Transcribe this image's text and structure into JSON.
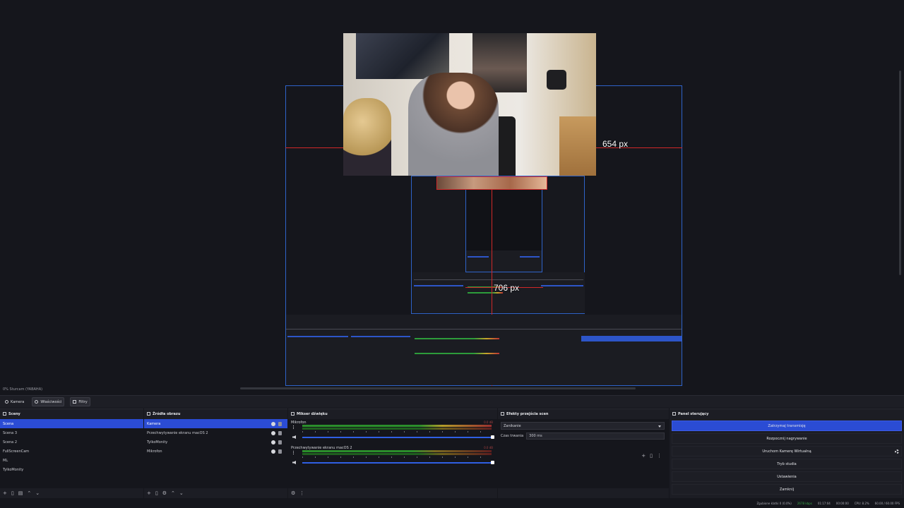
{
  "preview": {
    "measure_horizontal": "654 px",
    "measure_vertical": "706 px",
    "mini_status": "0%   Sturcam (YABAHA)"
  },
  "toolbar": {
    "source_name": "Kamera",
    "properties_label": "Właściwości",
    "filters_label": "Filtry"
  },
  "scenes": {
    "title": "Sceny",
    "items": [
      "Scena",
      "Scena 3",
      "Scena 2",
      "FullScreenCam",
      "ML",
      "TylkoMonity"
    ]
  },
  "sources": {
    "title": "Źródła obrazu",
    "items": [
      "Kamera",
      "Przechwytywanie ekranu macOS 2",
      "TylkoMonity",
      "Mikrofon"
    ]
  },
  "mixer": {
    "title": "Mikser dźwięku",
    "channels": [
      {
        "name": "Mikrofon",
        "db": "0.0 dB"
      },
      {
        "name": "Przechwytywanie ekranu macOS 2",
        "db": "0.0 dB"
      }
    ]
  },
  "transitions": {
    "title": "Efekty przejścia scen",
    "selected": "Zanikanie",
    "duration_label": "Czas trwania",
    "duration_value": "300 ms"
  },
  "controls": {
    "title": "Panel sterujący",
    "buttons": [
      "Zatrzymaj transmisję",
      "Rozpocznij nagrywanie",
      "Uruchom Kamerę Wirtualną",
      "Tryb studia",
      "Ustawienia",
      "Zamknij"
    ]
  },
  "status": {
    "dropped": "Zgubione klatki 0 (0.0%)",
    "bitrate": "2678 kbps",
    "stream_time": "01:17:04",
    "rec_time": "00:00:00",
    "cpu": "CPU: 8.2%",
    "fps": "60.00 / 60.00 FPS"
  },
  "colors": {
    "accent": "#2b4cd4",
    "guide": "#d12828",
    "canvas_border": "#2f63c9"
  }
}
